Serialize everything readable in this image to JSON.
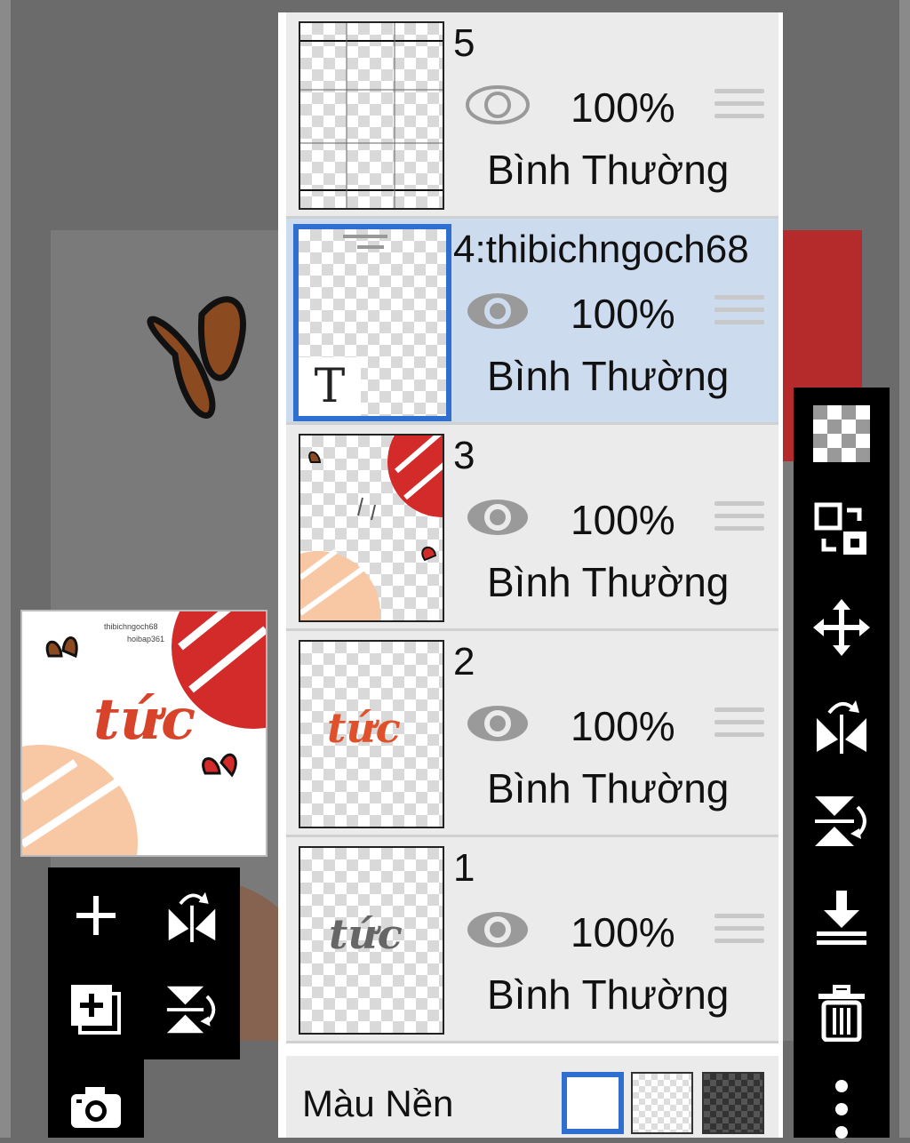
{
  "layers": [
    {
      "name": "5",
      "opacity": "100%",
      "blend": "Bình Thường",
      "visible": true,
      "selected": false,
      "thumb": "grid-lines"
    },
    {
      "name": "4:thibichngoch68",
      "opacity": "100%",
      "blend": "Bình Thường",
      "visible": true,
      "selected": true,
      "thumb": "text-layer"
    },
    {
      "name": "3",
      "opacity": "100%",
      "blend": "Bình Thường",
      "visible": true,
      "selected": false,
      "thumb": "decorations"
    },
    {
      "name": "2",
      "opacity": "100%",
      "blend": "Bình Thường",
      "visible": true,
      "selected": false,
      "thumb": "colored-lettering"
    },
    {
      "name": "1",
      "opacity": "100%",
      "blend": "Bình Thường",
      "visible": true,
      "selected": false,
      "thumb": "gray-lettering"
    }
  ],
  "background": {
    "label": "Màu Nền",
    "options": [
      "white",
      "transparent",
      "dark-checker"
    ],
    "selected": "white"
  },
  "text_layer_icon": "T",
  "artwork": {
    "lettering": "tức",
    "caption_lines": [
      "thibichngoch68",
      "hoibap361"
    ]
  },
  "right_tools": [
    "transparency-checker-icon",
    "swap-layers-icon",
    "move-icon",
    "flip-horizontal-icon",
    "flip-vertical-icon",
    "merge-down-icon",
    "trash-icon",
    "more-vertical-icon"
  ],
  "left_tools": [
    "add-layer-icon",
    "flip-horizontal-icon",
    "duplicate-layer-icon",
    "flip-vertical-icon",
    "camera-icon"
  ],
  "colors": {
    "accent": "#2f6fd0",
    "selected_row": "#cddbee",
    "row": "#ebebeb",
    "toolbar": "#000000"
  }
}
